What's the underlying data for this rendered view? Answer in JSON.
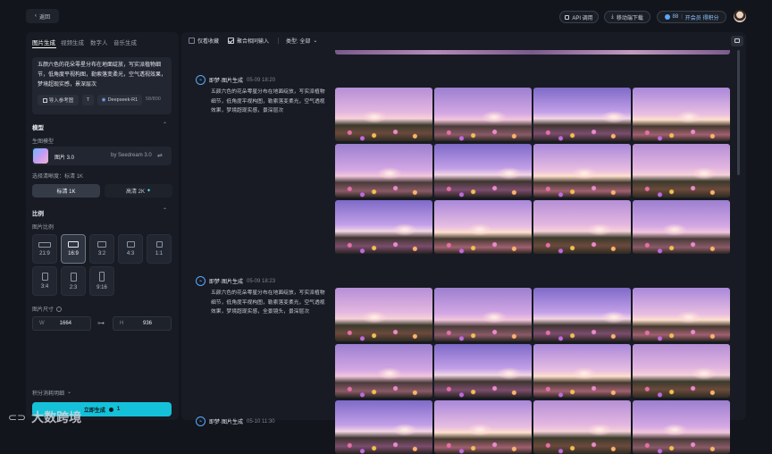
{
  "header": {
    "back_label": "返回",
    "api_label": "API 调用",
    "mobile_label": "移动端下载",
    "credits_value": "88",
    "credits_label": "开会员 得积分"
  },
  "sidebar": {
    "tabs": [
      "图片生成",
      "视频生成",
      "数字人",
      "音乐生成"
    ],
    "prompt_text": "五颜六色的花朵零星分布在地面绽放，写实派植物细节，低角度平视构图，勒索落变柔光，空气透视效果，梦境超现实感，景深层次",
    "ref_button": "导入参考图",
    "model_chip": "Deepseek-R1",
    "counter": "58/800",
    "model_section": "模型",
    "gen_model_label": "生图模型",
    "model_name": "图片 3.0",
    "model_provider": "by Seedream 3.0",
    "clarity_label": "选择清晰度：标清 1K",
    "res_1k": "标清 1K",
    "res_2k": "高清 2K",
    "ratio_section": "比例",
    "ratio_label": "图片比例",
    "ratios": [
      "21:9",
      "16:9",
      "3:2",
      "4:3",
      "1:1",
      "3:4",
      "2:3",
      "9:16"
    ],
    "selected_ratio": "16:9",
    "size_label": "图片尺寸",
    "width_label": "W",
    "width_value": "1664",
    "height_label": "H",
    "height_value": "936",
    "credit_detail": "积分消耗明细",
    "generate_label": "立即生成",
    "generate_cost": "1"
  },
  "main": {
    "filter_favorites": "仅看收藏",
    "filter_aggregate": "聚合相同输入",
    "filter_type": "类型: 全部",
    "generations": [
      {
        "title": "即梦·图片生成",
        "time": "05-09 18:20",
        "prompt": "五颜六色的花朵零星分布在地面绽放，写实派植物细节，低角度平视构图，勒索落变柔光，空气透视效果，梦境超现实感，景深层次"
      },
      {
        "title": "即梦·图片生成",
        "time": "05-09 18:23",
        "prompt": "五颜六色的花朵零星分布在地面绽放，写实派植物细节，低角度平视构图，勒索落变柔光，空气透视效果，梦境超现实感，全景镜头，景深层次"
      },
      {
        "title": "即梦·图片生成",
        "time": "05-10 11:30",
        "prompt": ""
      }
    ]
  },
  "watermark": "大数跨境",
  "colors": {
    "accent": "#14c1d9",
    "background": "#12151c",
    "panel": "#181b23"
  }
}
